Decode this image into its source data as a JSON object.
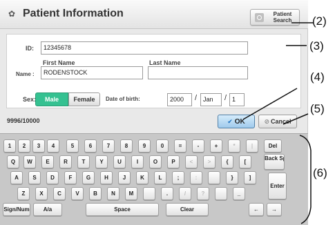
{
  "header": {
    "title": "Patient Information",
    "patient_search_label": "Patient\nSearch"
  },
  "form": {
    "id_label": "ID:",
    "id_value": "12345678",
    "first_name_label": "First Name",
    "last_name_label": "Last Name",
    "name_label": "Name :",
    "first_name_value": "RODENSTOCK",
    "last_name_value": "",
    "sex_label": "Sex:",
    "sex_options": [
      "Male",
      "Female"
    ],
    "sex_selected": "Male",
    "dob_label": "Date of birth:",
    "dob_year": "2000",
    "dob_month": "Jan",
    "dob_day": "1",
    "dob_separator": "/"
  },
  "status": {
    "count": "9996/10000",
    "ok_label": "OK",
    "cancel_label": "Cancel"
  },
  "keyboard": {
    "row1": [
      "1",
      "2",
      "3",
      "4",
      "5",
      "6",
      "7",
      "8",
      "9",
      "0",
      "=",
      "-",
      "+",
      "*",
      "|",
      "Del"
    ],
    "row2": [
      "Q",
      "W",
      "E",
      "R",
      "T",
      "Y",
      "U",
      "I",
      "O",
      "P",
      "<",
      ">",
      "{",
      "[",
      "Back Space"
    ],
    "row3": [
      "A",
      "S",
      "D",
      "F",
      "G",
      "H",
      "J",
      "K",
      "L",
      ";",
      ":",
      "",
      "}",
      "]",
      "Enter"
    ],
    "row4": [
      "Z",
      "X",
      "C",
      "V",
      "B",
      "N",
      "M",
      "",
      ".",
      "/",
      "?",
      "",
      "_"
    ],
    "row5": [
      "Sign/Num",
      "A/a",
      "Space",
      "Clear",
      "←",
      "→"
    ]
  },
  "callouts": [
    "(2)",
    "(3)",
    "(4)",
    "(5)",
    "(6)"
  ],
  "colors": {
    "selected_green": "#35c191",
    "ok_blue": "#9fcaec",
    "background": "#e9e9e9"
  }
}
